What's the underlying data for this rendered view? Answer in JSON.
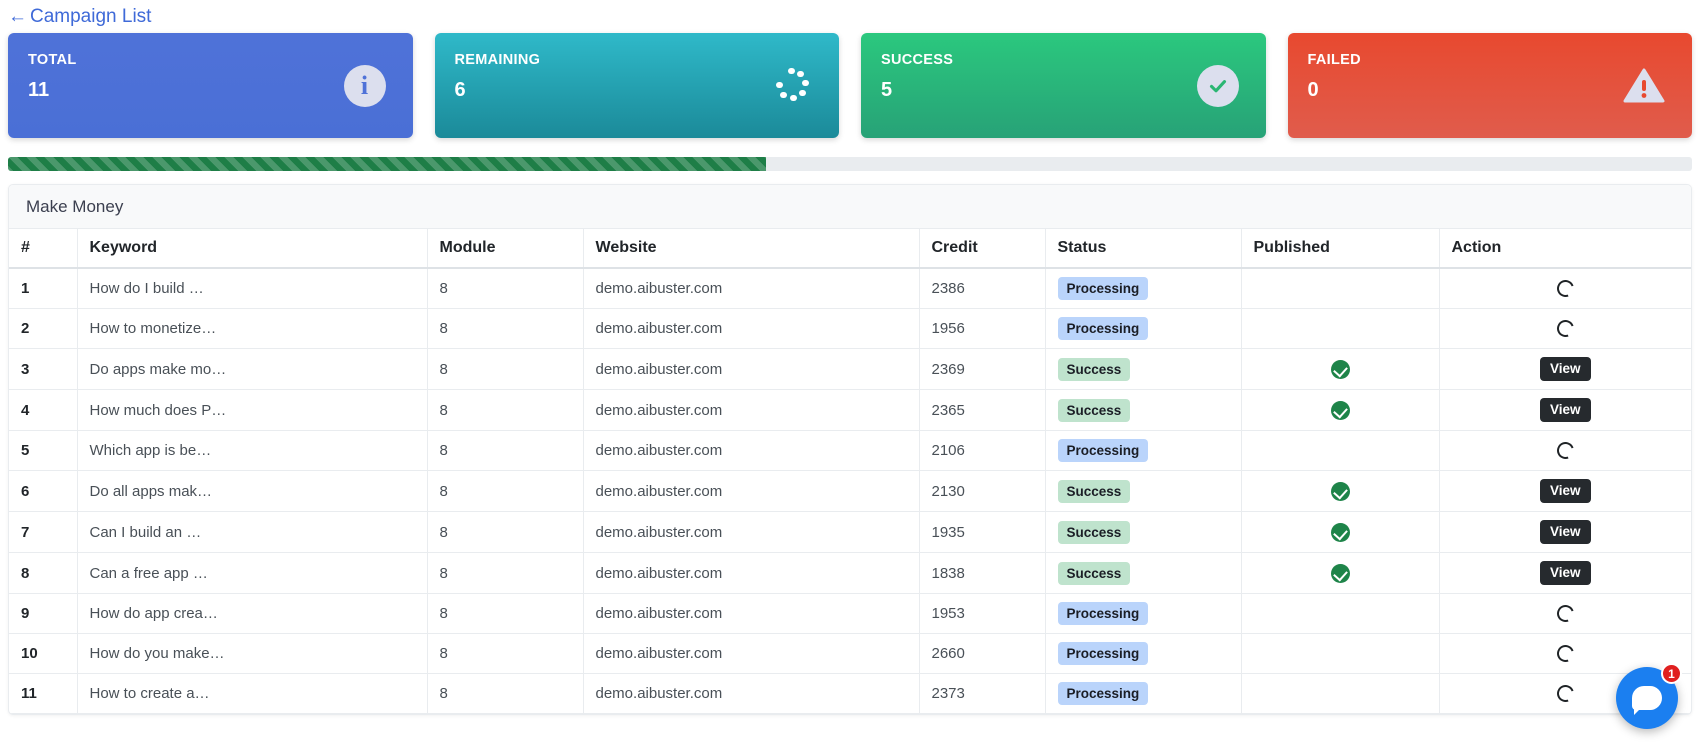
{
  "back_link": {
    "label": "Campaign List",
    "icon": "arrow-left-icon",
    "arrow": "←"
  },
  "cards": [
    {
      "title": "TOTAL",
      "value": "11",
      "icon": "info-icon",
      "color": "#4f72d8"
    },
    {
      "title": "REMAINING",
      "value": "6",
      "icon": "spinner-dots-icon",
      "color": "#2fb9c9"
    },
    {
      "title": "SUCCESS",
      "value": "5",
      "icon": "check-circle-icon",
      "color": "#2bc87e"
    },
    {
      "title": "FAILED",
      "value": "0",
      "icon": "warning-triangle-icon",
      "color": "#e8492f"
    }
  ],
  "progress": {
    "percent": 45,
    "color": "#1e7e47"
  },
  "panel": {
    "title": "Make Money"
  },
  "table": {
    "columns": [
      "#",
      "Keyword",
      "Module",
      "Website",
      "Credit",
      "Status",
      "Published",
      "Action"
    ],
    "rows": [
      {
        "idx": "1",
        "keyword": "How do I build …",
        "module": "8",
        "website": "demo.aibuster.com",
        "credit": "2386",
        "status": "Processing",
        "published": false,
        "action": "spinner"
      },
      {
        "idx": "2",
        "keyword": "How to monetize…",
        "module": "8",
        "website": "demo.aibuster.com",
        "credit": "1956",
        "status": "Processing",
        "published": false,
        "action": "spinner"
      },
      {
        "idx": "3",
        "keyword": "Do apps make mo…",
        "module": "8",
        "website": "demo.aibuster.com",
        "credit": "2369",
        "status": "Success",
        "published": true,
        "action": "View"
      },
      {
        "idx": "4",
        "keyword": "How much does P…",
        "module": "8",
        "website": "demo.aibuster.com",
        "credit": "2365",
        "status": "Success",
        "published": true,
        "action": "View"
      },
      {
        "idx": "5",
        "keyword": "Which app is be…",
        "module": "8",
        "website": "demo.aibuster.com",
        "credit": "2106",
        "status": "Processing",
        "published": false,
        "action": "spinner"
      },
      {
        "idx": "6",
        "keyword": "Do all apps mak…",
        "module": "8",
        "website": "demo.aibuster.com",
        "credit": "2130",
        "status": "Success",
        "published": true,
        "action": "View"
      },
      {
        "idx": "7",
        "keyword": "Can I build an …",
        "module": "8",
        "website": "demo.aibuster.com",
        "credit": "1935",
        "status": "Success",
        "published": true,
        "action": "View"
      },
      {
        "idx": "8",
        "keyword": "Can a free app …",
        "module": "8",
        "website": "demo.aibuster.com",
        "credit": "1838",
        "status": "Success",
        "published": true,
        "action": "View"
      },
      {
        "idx": "9",
        "keyword": "How do app crea…",
        "module": "8",
        "website": "demo.aibuster.com",
        "credit": "1953",
        "status": "Processing",
        "published": false,
        "action": "spinner"
      },
      {
        "idx": "10",
        "keyword": "How do you make…",
        "module": "8",
        "website": "demo.aibuster.com",
        "credit": "2660",
        "status": "Processing",
        "published": false,
        "action": "spinner"
      },
      {
        "idx": "11",
        "keyword": "How to create a…",
        "module": "8",
        "website": "demo.aibuster.com",
        "credit": "2373",
        "status": "Processing",
        "published": false,
        "action": "spinner"
      }
    ]
  },
  "chat": {
    "badge_count": "1",
    "icon": "chat-bubble-icon"
  }
}
